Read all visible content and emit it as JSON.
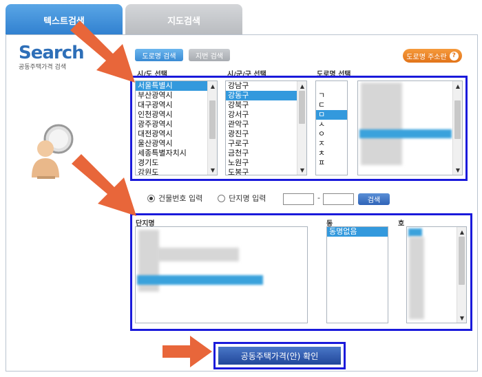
{
  "tabs": {
    "text_search": "텍스트검색",
    "map_search": "지도검색"
  },
  "logo": {
    "word": "Search",
    "subtitle": "공동주택가격 검색"
  },
  "buttons": {
    "road_search": "도로명 검색",
    "lot_search": "지번 검색",
    "road_address_help": "도로명 주소란",
    "help_symbol": "?",
    "search": "검색",
    "confirm": "공동주택가격(안) 확인"
  },
  "labels": {
    "sido": "시/도 선택",
    "sigungu": "시/군/구 선택",
    "road": "도로명 선택",
    "complex": "단지명",
    "dong": "동",
    "ho": "호"
  },
  "sido_list": [
    "서울특별시",
    "부산광역시",
    "대구광역시",
    "인천광역시",
    "광주광역시",
    "대전광역시",
    "울산광역시",
    "세종특별자치시",
    "경기도",
    "강원도"
  ],
  "sido_selected_index": 0,
  "sigungu_list": [
    "강남구",
    "강동구",
    "강북구",
    "강서구",
    "관악구",
    "광진구",
    "구로구",
    "금천구",
    "노원구",
    "도봉구"
  ],
  "sigungu_selected_index": 1,
  "initial_list": [
    "ㄱ",
    "ㄷ",
    "ㅁ",
    "ㅅ",
    "ㅇ",
    "ㅈ",
    "ㅊ",
    "ㅍ"
  ],
  "initial_selected_index": 2,
  "dong_list": [
    "동명없음"
  ],
  "dong_selected_index": 0,
  "input_mode": {
    "building_number": "건물번호 입력",
    "complex_name": "단지명 입력",
    "selected": "building_number"
  },
  "range_inputs": {
    "from": "",
    "to": "",
    "separator": "-"
  },
  "colors": {
    "highlight_box": "#1a1adb",
    "arrow": "#e8663a",
    "selection": "#3399dd",
    "brand": "#2e6fb8"
  }
}
